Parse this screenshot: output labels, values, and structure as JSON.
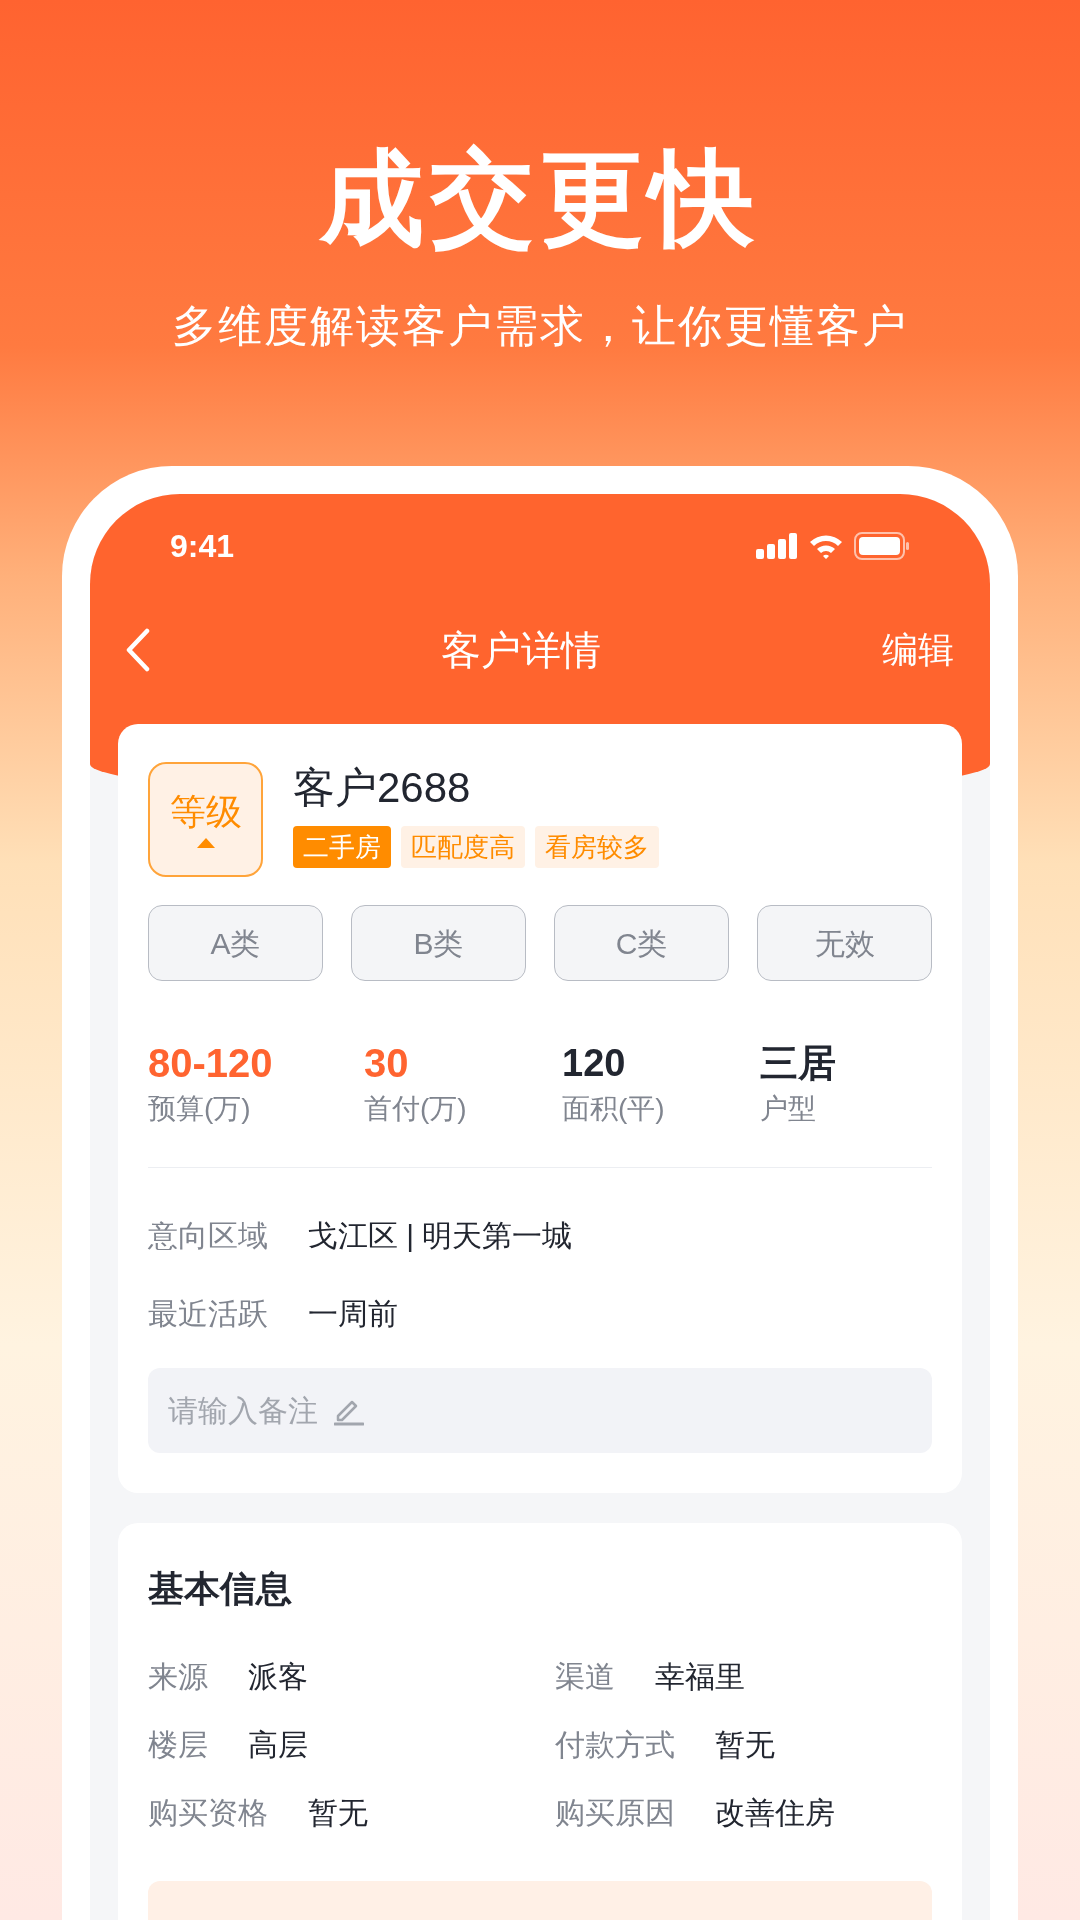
{
  "promo": {
    "title": "成交更快",
    "subtitle": "多维度解读客户需求，让你更懂客户"
  },
  "status_bar": {
    "time": "9:41"
  },
  "nav": {
    "title": "客户详情",
    "action": "编辑"
  },
  "customer": {
    "level_label": "等级",
    "name": "客户2688",
    "tags": [
      {
        "label": "二手房",
        "filled": true
      },
      {
        "label": "匹配度高",
        "filled": false
      },
      {
        "label": "看房较多",
        "filled": false
      }
    ]
  },
  "categories": [
    {
      "label": "A类"
    },
    {
      "label": "B类"
    },
    {
      "label": "C类"
    },
    {
      "label": "无效"
    }
  ],
  "stats": [
    {
      "value": "80-120",
      "label": "预算(万)",
      "accent": true
    },
    {
      "value": "30",
      "label": "首付(万)",
      "accent": true
    },
    {
      "value": "120",
      "label": "面积(平)",
      "accent": false
    },
    {
      "value": "三居",
      "label": "户型",
      "accent": false
    }
  ],
  "details": [
    {
      "label": "意向区域",
      "value": "戈江区 | 明天第一城"
    },
    {
      "label": "最近活跃",
      "value": "一周前"
    }
  ],
  "note": {
    "placeholder": "请输入备注"
  },
  "basic_info": {
    "title": "基本信息",
    "fields": [
      {
        "label": "来源",
        "value": "派客"
      },
      {
        "label": "渠道",
        "value": "幸福里"
      },
      {
        "label": "楼层",
        "value": "高层"
      },
      {
        "label": "付款方式",
        "value": "暂无"
      },
      {
        "label": "购买资格",
        "value": "暂无"
      },
      {
        "label": "购买原因",
        "value": "改善住房"
      }
    ]
  }
}
